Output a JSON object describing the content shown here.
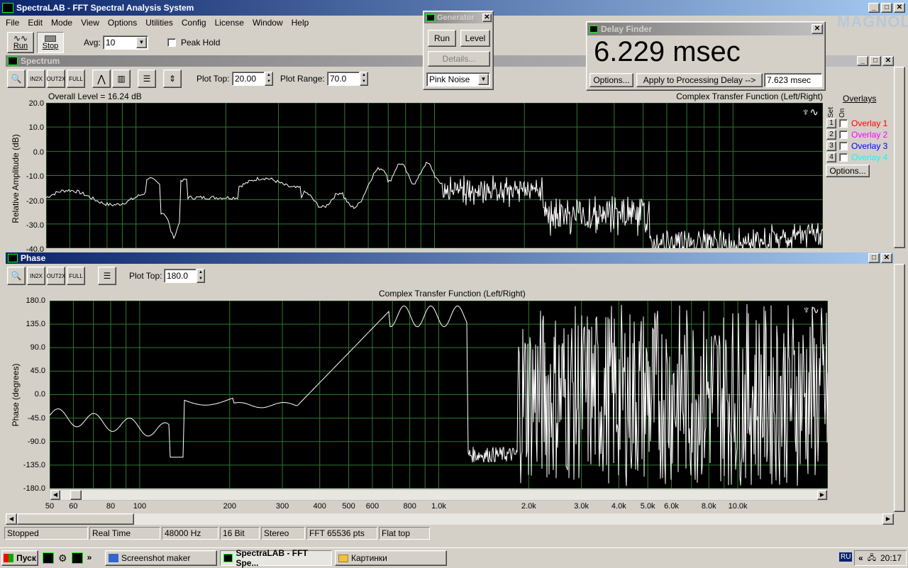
{
  "app": {
    "title": "SpectraLAB - FFT Spectral Analysis System"
  },
  "menu": [
    "File",
    "Edit",
    "Mode",
    "View",
    "Options",
    "Utilities",
    "Config",
    "License",
    "Window",
    "Help"
  ],
  "toolbar": {
    "run": "Run",
    "stop": "Stop",
    "avg_label": "Avg:",
    "avg_value": "10",
    "peak_hold": "Peak Hold"
  },
  "spectrum": {
    "title": "Spectrum",
    "plot_top_label": "Plot Top:",
    "plot_top": "20.00",
    "plot_range_label": "Plot Range:",
    "plot_range": "70.0",
    "overall": "Overall Level = 16.24 dB",
    "tf_label": "Complex Transfer Function (Left/Right)",
    "ylabel": "Relative Amplitude (dB)",
    "yticks": [
      "20.0",
      "10.0",
      "0.0",
      "-10.0",
      "-20.0",
      "-30.0",
      "-40.0"
    ]
  },
  "overlays": {
    "title": "Overlays",
    "set": "Set",
    "on": "On",
    "options": "Options...",
    "items": [
      {
        "n": "1",
        "label": "Overlay 1",
        "color": "#ff0000"
      },
      {
        "n": "2",
        "label": "Overlay 2",
        "color": "#ff00ff"
      },
      {
        "n": "3",
        "label": "Overlay 3",
        "color": "#0000ff"
      },
      {
        "n": "4",
        "label": "Overlay 4",
        "color": "#00ffff"
      }
    ]
  },
  "phase": {
    "title": "Phase",
    "plot_top_label": "Plot Top:",
    "plot_top": "180.0",
    "tf_label": "Complex Transfer Function (Left/Right)",
    "ylabel": "Phase (degrees)",
    "yticks": [
      "180.0",
      "135.0",
      "90.0",
      "45.0",
      "0.0",
      "-45.0",
      "-90.0",
      "-135.0",
      "-180.0"
    ],
    "xticks": [
      "50",
      "60",
      "80",
      "100",
      "200",
      "300",
      "400",
      "500",
      "600",
      "800",
      "1.0k",
      "2.0k",
      "3.0k",
      "4.0k",
      "5.0k",
      "6.0k",
      "8.0k",
      "10.0k"
    ]
  },
  "generator": {
    "title": "Generator",
    "run": "Run",
    "level": "Level",
    "details": "Details...",
    "signal": "Pink Noise"
  },
  "delay": {
    "title": "Delay Finder",
    "value": "6.229 msec",
    "options": "Options...",
    "apply": "Apply to Processing Delay -->",
    "current": "7.623 msec"
  },
  "status": [
    "Stopped",
    "Real Time",
    "48000 Hz",
    "16 Bit",
    "Stereo",
    "FFT 65536 pts",
    "Flat top"
  ],
  "taskbar": {
    "start": "Пуск",
    "items": [
      "Screenshot maker",
      "SpectraLAB - FFT Spe...",
      "Картинки"
    ],
    "lang": "RU",
    "clock": "20:17"
  },
  "logo": {
    "text": "MAGNOLIA"
  },
  "colors": {
    "grid": "#2f7a2f",
    "trace": "#ffffff",
    "title_active": "#0a246a"
  }
}
